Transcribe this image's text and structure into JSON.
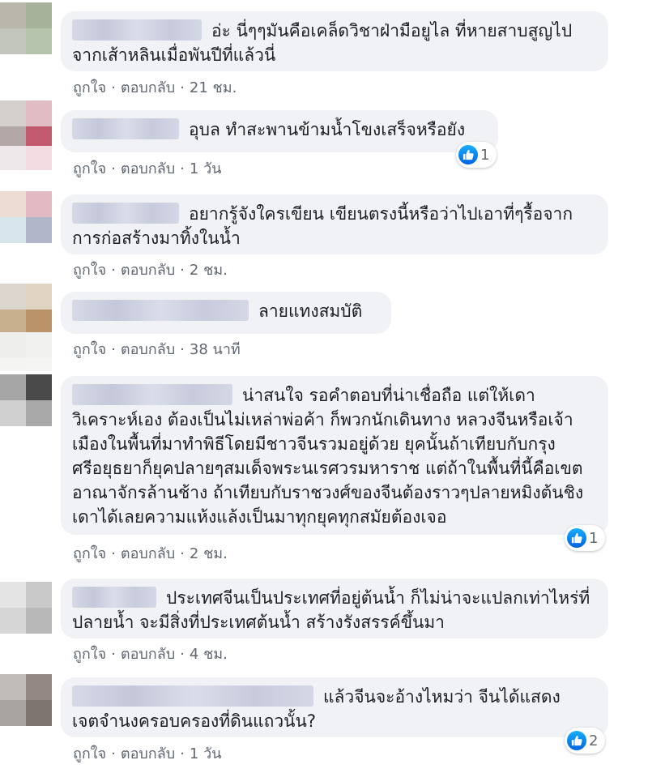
{
  "actions": {
    "like": "ถูกใจ",
    "reply": "ตอบกลับ",
    "dot": "·"
  },
  "reaction_type": "like-icon",
  "comments": [
    {
      "text": "อ่ะ นี่ๆๆมันคือเคล็ดวิชาฝ่ามือยูไล ที่หายสาบสูญไปจากเส้าหลินเมื่อพันปีที่แล้วนี่",
      "time": "21 ชม."
    },
    {
      "text": "อุบล ทำสะพานข้ามน้ำโขงเสร็จหรือยัง",
      "time": "1 วัน",
      "reactions": "1"
    },
    {
      "text": "อยากรู้จังใครเขียน เขียนตรงนี้หรือว่าไปเอาที่ๆรื้อจากการก่อสร้างมาทิ้งในน้ำ",
      "time": "2 ชม."
    },
    {
      "text": "ลายแทงสมบัติ",
      "time": "38 นาที"
    },
    {
      "text": "น่าสนใจ รอคำตอบที่น่าเชื่อถือ แต่ให้เดาวิเคราะห์เอง ต้องเป็นไม่เหล่าพ่อค้า ก็พวกนักเดินทาง หลวงจีนหรือเจ้าเมืองในพื้นที่มาทำพิธีโดยมีชาวจีนรวมอยู่ด้วย ยุคนั้นถ้าเทียบกับกรุงศรีอยุธยาก็ยุคปลายๆสมเด็จพระนเรศวรมหาราช แต่ถ้าในพื้นที่นี้คือเขตอาณาจักรล้านช้าง ถ้าเทียบกับราชวงศ์ของจีนต้องราวๆปลายหมิงต้นชิง เดาได้เลยความแห้งแล้งเป็นมาทุกยุคทุกสมัยต้องเจอ",
      "time": "2 ชม.",
      "reactions": "1"
    },
    {
      "text": "ประเทศจีนเป็นประเทศที่อยู่ต้นน้ำ ก็ไม่น่าจะแปลกเท่าไหร่ที่ ปลายน้ำ จะมีสิ่งที่ประเทศต้นน้ำ สร้างรังสรรค์ขึ้นมา",
      "time": "4 ชม."
    },
    {
      "text": "แล้วจีนจะอ้างไหมว่า จีนได้แสดงเจตจำนงครอบครองที่ดินแถวนั้น?",
      "time": "1 วัน",
      "reactions": "2"
    }
  ]
}
